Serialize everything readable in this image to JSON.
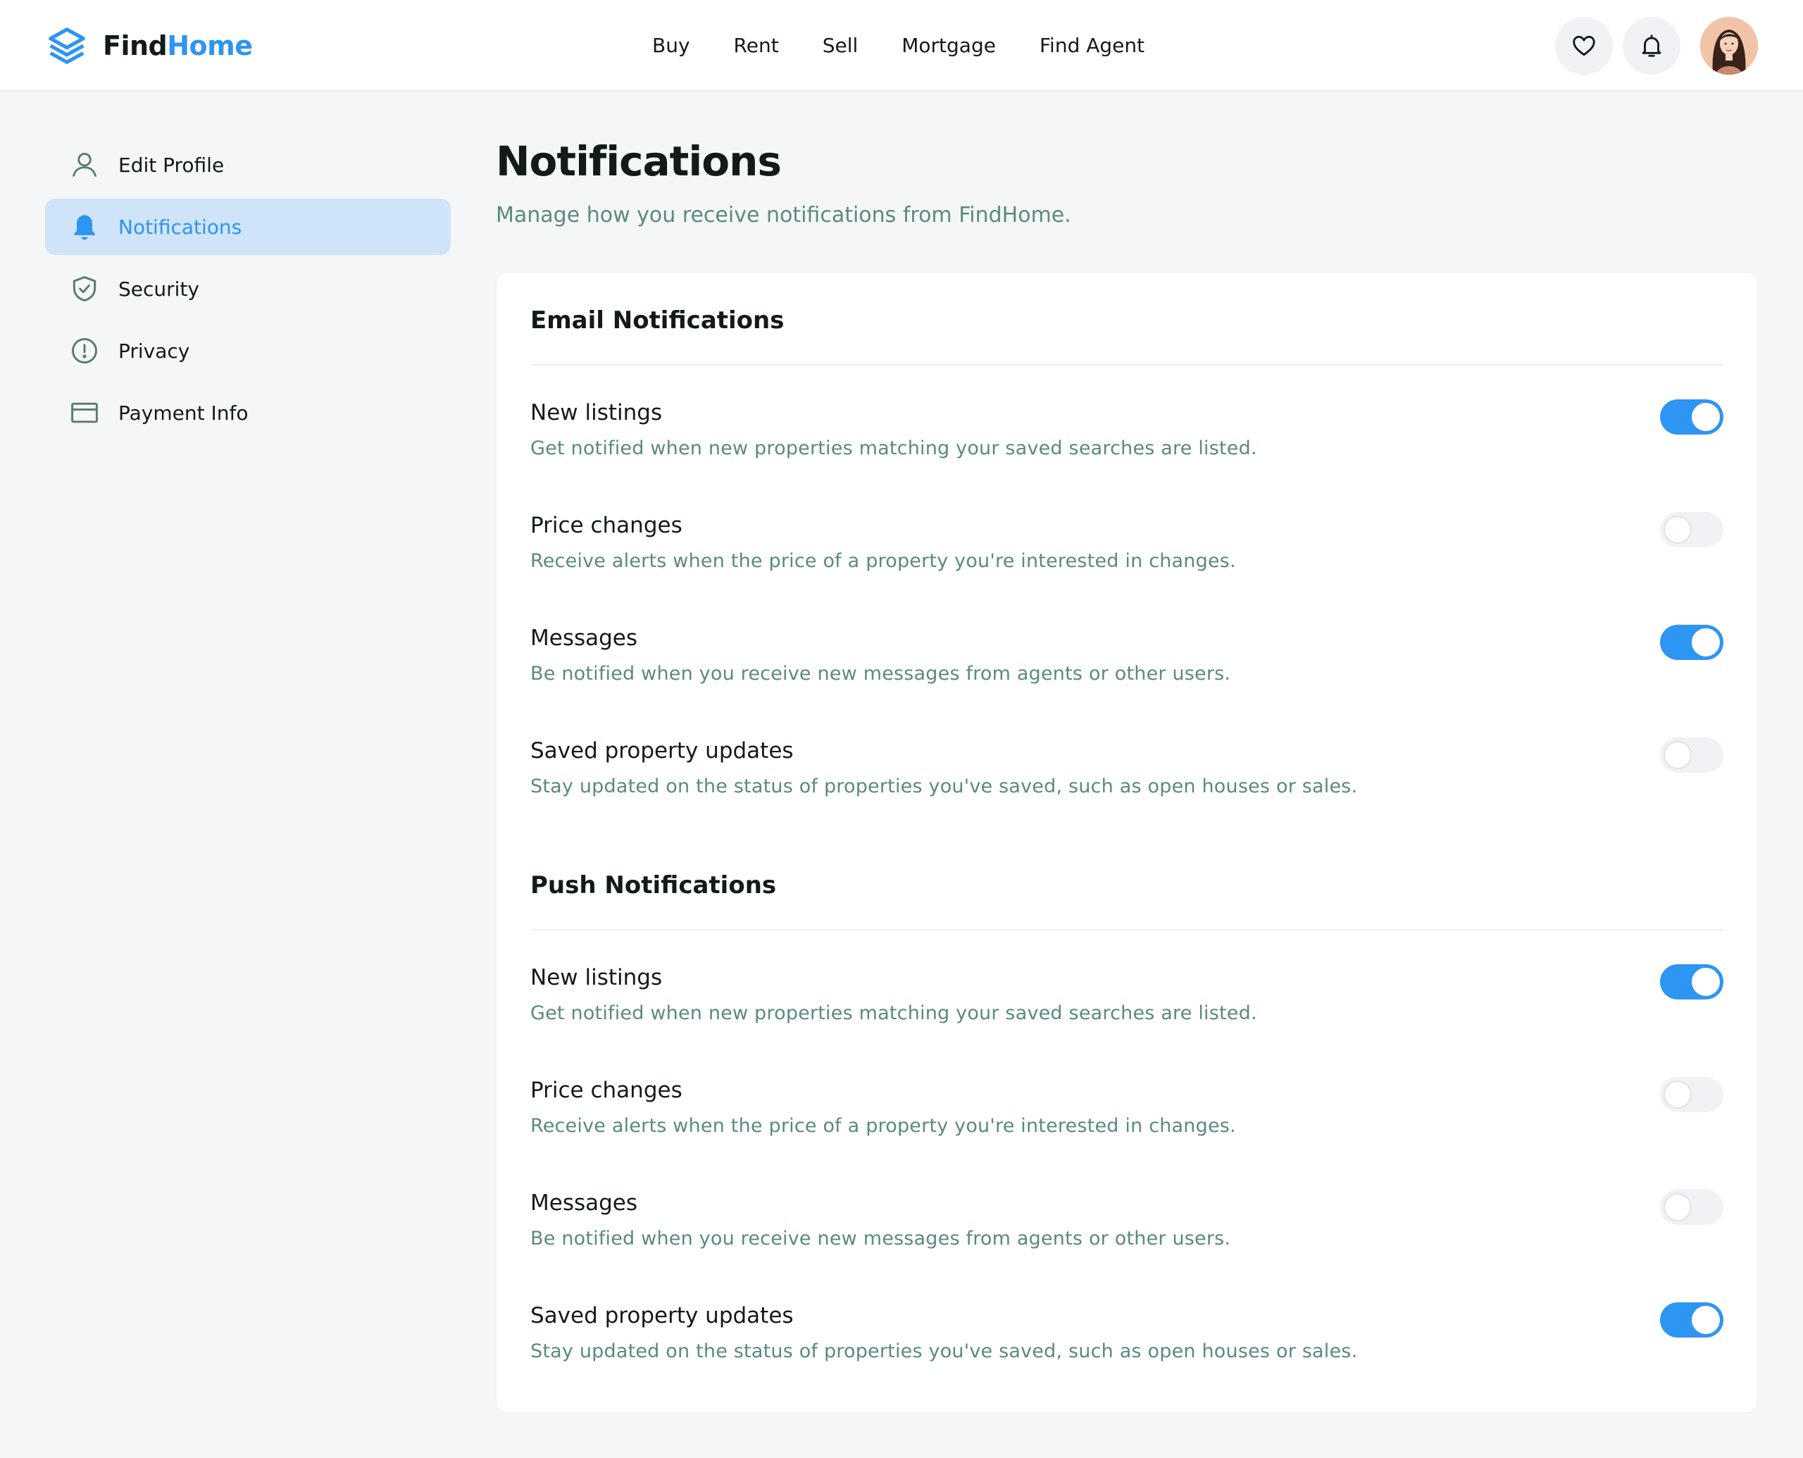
{
  "brand": {
    "find": "Find",
    "home": "Home",
    "accent": "#2d95f2"
  },
  "nav": [
    "Buy",
    "Rent",
    "Sell",
    "Mortgage",
    "Find Agent"
  ],
  "header_icons": [
    "heart-icon",
    "bell-icon"
  ],
  "sidebar": {
    "items": [
      {
        "label": "Edit Profile",
        "icon": "user-icon",
        "active": false
      },
      {
        "label": "Notifications",
        "icon": "bell-icon",
        "active": true
      },
      {
        "label": "Security",
        "icon": "shield-check-icon",
        "active": false
      },
      {
        "label": "Privacy",
        "icon": "alert-circle-icon",
        "active": false
      },
      {
        "label": "Payment Info",
        "icon": "credit-card-icon",
        "active": false
      }
    ]
  },
  "main": {
    "title": "Notifications",
    "subtitle": "Manage how you receive notifications from FindHome.",
    "sections": [
      {
        "title": "Email Notifications",
        "rows": [
          {
            "title": "New listings",
            "desc": "Get notified when new properties matching your saved searches are listed.",
            "enabled": true
          },
          {
            "title": "Price changes",
            "desc": "Receive alerts when the price of a property you're interested in changes.",
            "enabled": false
          },
          {
            "title": "Messages",
            "desc": "Be notified when you receive new messages from agents or other users.",
            "enabled": true
          },
          {
            "title": "Saved property updates",
            "desc": "Stay updated on the status of properties you've saved, such as open houses or sales.",
            "enabled": false
          }
        ]
      },
      {
        "title": "Push Notifications",
        "rows": [
          {
            "title": "New listings",
            "desc": "Get notified when new properties matching your saved searches are listed.",
            "enabled": true
          },
          {
            "title": "Price changes",
            "desc": "Receive alerts when the price of a property you're interested in changes.",
            "enabled": false
          },
          {
            "title": "Messages",
            "desc": "Be notified when you receive new messages from agents or other users.",
            "enabled": false
          },
          {
            "title": "Saved property updates",
            "desc": "Stay updated on the status of properties you've saved, such as open houses or sales.",
            "enabled": true
          }
        ]
      }
    ]
  }
}
